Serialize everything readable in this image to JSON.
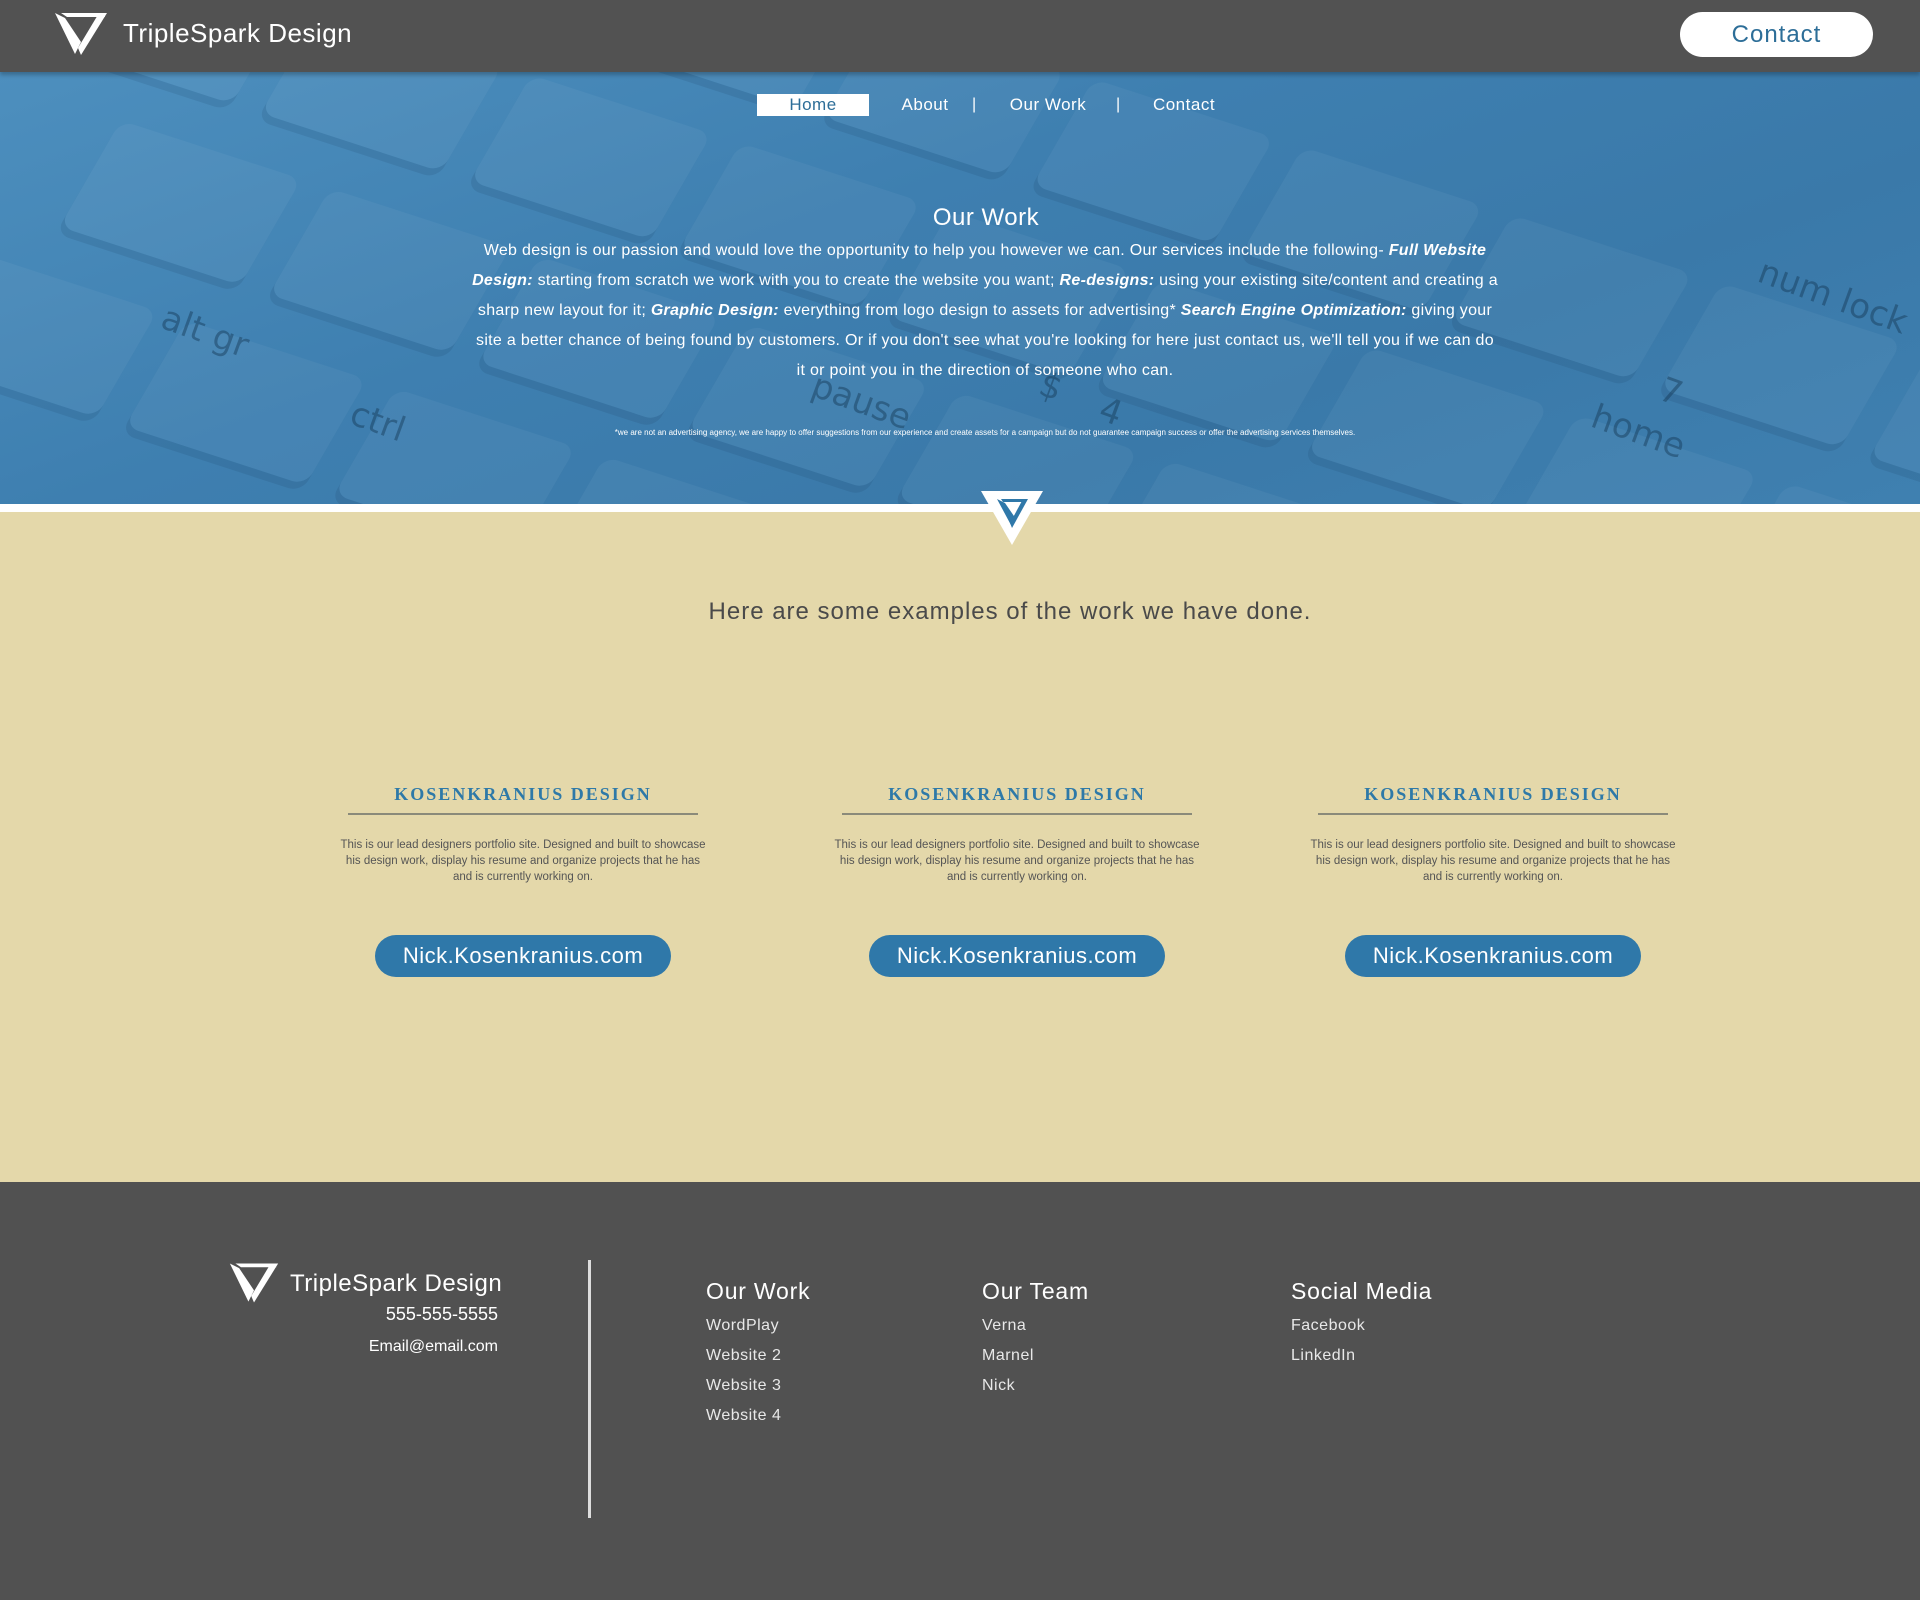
{
  "header": {
    "brand": "TripleSpark Design",
    "contact_button": "Contact"
  },
  "nav": {
    "items": [
      "Home",
      "About",
      "Our Work",
      "Contact"
    ],
    "active": "Home",
    "separator": "|"
  },
  "hero": {
    "title": "Our Work",
    "desc": {
      "p1": "Web design is our passion and would love the opportunity to help you however we can. Our services include the following- ",
      "e1": "Full Website Design:",
      "p2": " starting from scratch we work with you to create the website you want; ",
      "e2": "Re-designs:",
      "p3": " using your existing site/content and creating a sharp new layout for it; ",
      "e3": "Graphic Design:",
      "p4": " everything from logo design to assets for advertising* ",
      "e4": "Search Engine Optimization:",
      "p5": " giving your site a better chance of being found by customers. Or if you don't see what you're looking for here just contact us, we'll tell you if we can do it or point you in the direction of someone who can."
    },
    "fine_print": "*we are not an advertising agency, we are happy to offer suggestions from our experience and create assets for a campaign but do not guarantee campaign success or offer the advertising services themselves.",
    "key_labels": [
      "ctrl",
      "alt gr",
      "pause",
      "home",
      "num lock",
      "7",
      "$",
      "4"
    ]
  },
  "examples": {
    "title": "Here are some examples of the work we have done.",
    "cards": [
      {
        "title": "KOSENKRANIUS DESIGN",
        "desc": "This is our lead designers portfolio site. Designed and built to showcase his design work, display his resume and organize projects that he has and is currently working on.",
        "link": "Nick.Kosenkranius.com"
      },
      {
        "title": "KOSENKRANIUS DESIGN",
        "desc": "This is our lead designers portfolio site. Designed and built to showcase his design work, display his resume and organize projects that he has and is currently working on.",
        "link": "Nick.Kosenkranius.com"
      },
      {
        "title": "KOSENKRANIUS DESIGN",
        "desc": "This is our lead designers portfolio site. Designed and built to showcase his design work, display his resume and organize projects that he has and is currently working on.",
        "link": "Nick.Kosenkranius.com"
      }
    ]
  },
  "footer": {
    "brand": "TripleSpark Design",
    "phone": "555-555-5555",
    "email": "Email@email.com",
    "columns": [
      {
        "heading": "Our Work",
        "links": [
          "WordPlay",
          "Website 2",
          "Website 3",
          "Website 4"
        ]
      },
      {
        "heading": "Our Team",
        "links": [
          "Verna",
          "Marnel",
          "Nick"
        ]
      },
      {
        "heading": "Social Media",
        "links": [
          "Facebook",
          "LinkedIn"
        ]
      }
    ]
  },
  "colors": {
    "header_bg": "#525252",
    "hero_blue": "#3e7fb0",
    "accent_blue": "#2f78a9",
    "sand_bg": "#e4d8aa",
    "footer_bg": "#515151"
  },
  "icons": {
    "logo": "triple-triangle-logo-icon",
    "divider": "inverted-triangle-icon"
  }
}
